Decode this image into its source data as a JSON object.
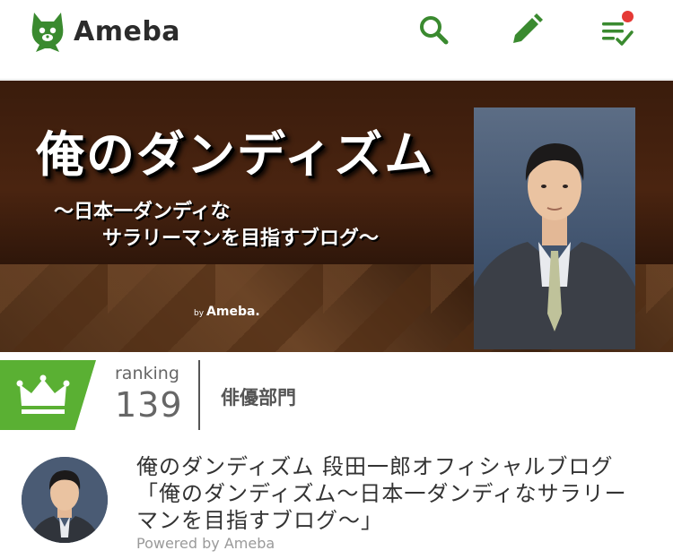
{
  "header": {
    "logo_text": "Ameba",
    "icons": [
      "search-icon",
      "pen-icon",
      "notification-list-icon"
    ],
    "accent_color": "#3a8a2f",
    "notification_dot_color": "#e53935"
  },
  "banner": {
    "title": "俺のダンディズム",
    "subtitle_line1": "〜日本一ダンディな",
    "subtitle_line2": "サラリーマンを目指すブログ〜",
    "by_label": "by",
    "by_brand": "Ameba."
  },
  "ranking": {
    "label": "ranking",
    "number": "139",
    "category": "俳優部門",
    "badge_color": "#5ab033"
  },
  "profile": {
    "blog_title": "俺のダンディズム 段田一郎オフィシャルブログ「俺のダンディズム〜日本一ダンディなサラリーマンを目指すブログ〜」",
    "powered_by": "Powered by Ameba"
  }
}
